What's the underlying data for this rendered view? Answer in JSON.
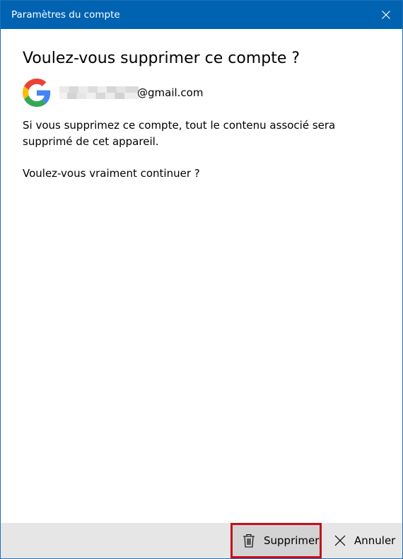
{
  "window": {
    "title": "Paramètres du compte",
    "accent_color": "#0063b1"
  },
  "dialog": {
    "heading": "Voulez-vous supprimer ce compte ?",
    "account": {
      "provider_icon": "google-logo-icon",
      "email_suffix": "@gmail.com"
    },
    "message": "Si vous supprimez ce compte, tout le contenu associé sera supprimé de cet appareil.",
    "confirm": "Voulez-vous vraiment continuer ?"
  },
  "footer": {
    "delete_label": "Supprimer",
    "delete_icon": "trash-icon",
    "cancel_label": "Annuler",
    "cancel_icon": "close-icon",
    "highlight_color": "#c4101c"
  }
}
